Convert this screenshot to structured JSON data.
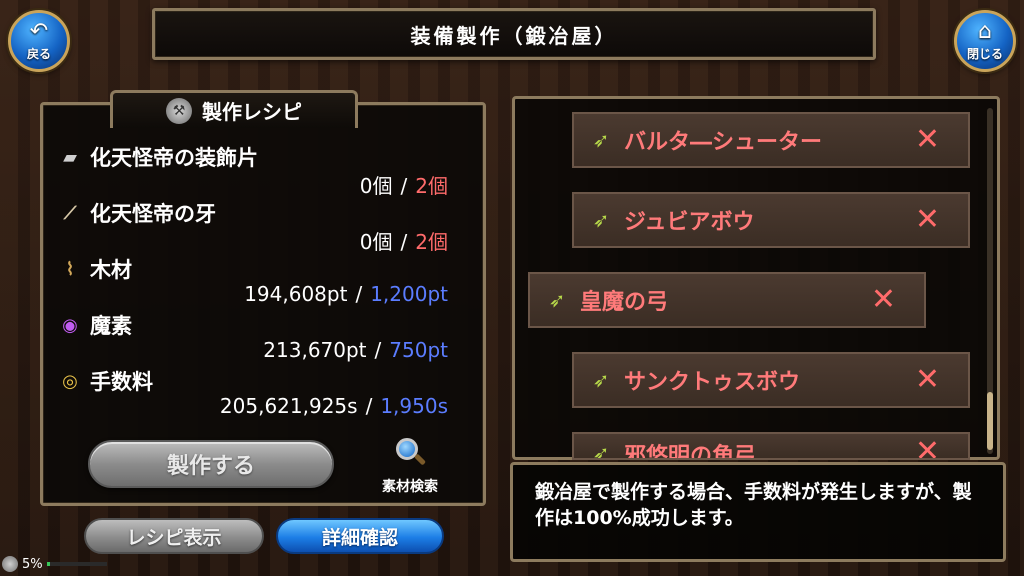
{
  "title": "装備製作（鍛冶屋）",
  "nav": {
    "back_label": "戻る",
    "close_label": "閉じる"
  },
  "recipe_panel": {
    "tab_label": "製作レシピ",
    "materials": [
      {
        "name": "化天怪帝の装飾片",
        "have": "0個",
        "need": "2個",
        "icon": "ornament-fragment-icon",
        "need_color": "red"
      },
      {
        "name": "化天怪帝の牙",
        "have": "0個",
        "need": "2個",
        "icon": "fang-icon",
        "need_color": "red"
      },
      {
        "name": "木材",
        "have": "194,608pt",
        "need": "1,200pt",
        "icon": "wood-icon",
        "need_color": "blue"
      },
      {
        "name": "魔素",
        "have": "213,670pt",
        "need": "750pt",
        "icon": "magic-essence-icon",
        "need_color": "blue"
      },
      {
        "name": "手数料",
        "have": "205,621,925s",
        "need": "1,950s",
        "icon": "coins-icon",
        "need_color": "blue"
      }
    ],
    "separator": "/",
    "craft_label": "製作する",
    "search_material_label": "素材検索"
  },
  "buttons": {
    "recipe_display": "レシピ表示",
    "detail_confirm": "詳細確認"
  },
  "recipe_list": [
    {
      "name": "バルタ―シューター",
      "mark": "✕"
    },
    {
      "name": "ジュビアボウ",
      "mark": "✕"
    },
    {
      "name": "皇魔の弓",
      "mark": "✕",
      "selected": true
    },
    {
      "name": "サンクトゥスボウ",
      "mark": "✕"
    },
    {
      "name": "邪悠明の角弓",
      "mark": "✕"
    }
  ],
  "message": "鍛冶屋で製作する場合、手数料が発生しますが、製作は100%成功します。",
  "status": {
    "percent_label": "5%",
    "progress": 0.05
  },
  "colors": {
    "need_red": "#ff6b6b",
    "need_blue": "#5b7dff",
    "recipe_name": "#ff7a7a",
    "frame": "#8d7b5e"
  }
}
